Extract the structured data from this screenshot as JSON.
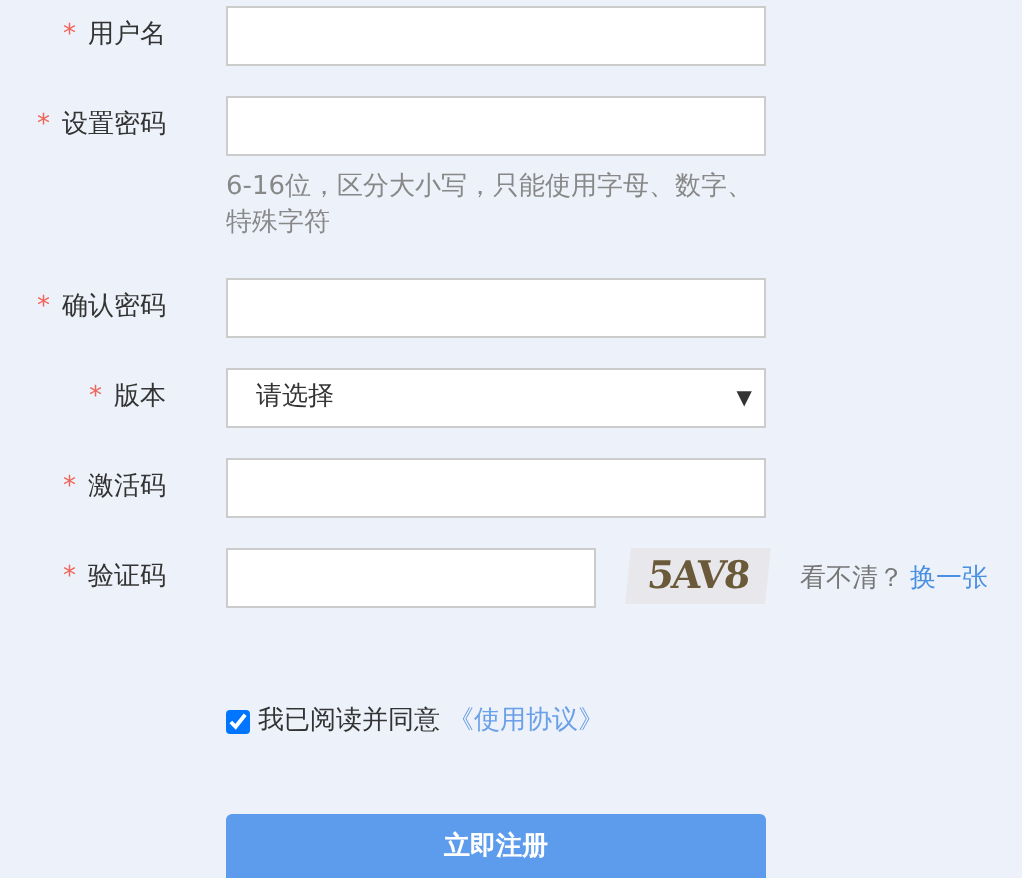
{
  "fields": [
    {
      "kind": "text",
      "marker": "*",
      "label": "用户名"
    },
    {
      "kind": "text",
      "marker": "*",
      "label": "设置密码",
      "hint": "6-16位，区分大小写，只能使用字母、数字、特殊字符"
    },
    {
      "kind": "text",
      "marker": "*",
      "label": "确认密码"
    },
    {
      "kind": "select",
      "marker": "*",
      "label": "版本",
      "value": "请选择",
      "caret": "▼"
    },
    {
      "kind": "text",
      "marker": "*",
      "label": "激活码"
    },
    {
      "kind": "captcha",
      "marker": "*",
      "label": "验证码",
      "captcha": "5AV8",
      "prompt": "看不清？",
      "refresh": "换一张"
    }
  ],
  "agreement": {
    "checked": true,
    "text": "我已阅读并同意",
    "link": "《使用协议》"
  },
  "submit": "立即注册"
}
